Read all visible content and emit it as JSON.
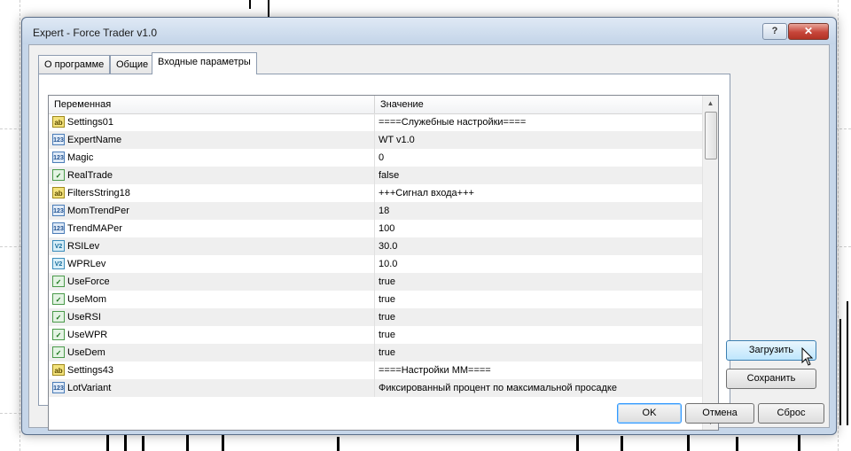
{
  "window": {
    "title": "Expert - Force Trader v1.0",
    "help_label": "?",
    "close_label": "✕"
  },
  "tabs": [
    {
      "label": "О программе",
      "active": false
    },
    {
      "label": "Общие",
      "active": false
    },
    {
      "label": "Входные параметры",
      "active": true
    }
  ],
  "grid": {
    "columns": [
      "Переменная",
      "Значение"
    ],
    "rows": [
      {
        "icon": "ab",
        "name": "Settings01",
        "value": "====Служебные настройки===="
      },
      {
        "icon": "123",
        "name": "ExpertName",
        "value": "WT v1.0"
      },
      {
        "icon": "123",
        "name": "Magic",
        "value": "0"
      },
      {
        "icon": "bool",
        "name": "RealTrade",
        "value": "false"
      },
      {
        "icon": "ab",
        "name": "FiltersString18",
        "value": "+++Сигнал входа+++"
      },
      {
        "icon": "123",
        "name": "MomTrendPer",
        "value": "18"
      },
      {
        "icon": "123",
        "name": "TrendMAPer",
        "value": "100"
      },
      {
        "icon": "dbl",
        "name": "RSILev",
        "value": "30.0"
      },
      {
        "icon": "dbl",
        "name": "WPRLev",
        "value": "10.0"
      },
      {
        "icon": "bool",
        "name": "UseForce",
        "value": "true"
      },
      {
        "icon": "bool",
        "name": "UseMom",
        "value": "true"
      },
      {
        "icon": "bool",
        "name": "UseRSI",
        "value": "true"
      },
      {
        "icon": "bool",
        "name": "UseWPR",
        "value": "true"
      },
      {
        "icon": "bool",
        "name": "UseDem",
        "value": "true"
      },
      {
        "icon": "ab",
        "name": "Settings43",
        "value": "====Настройки ММ===="
      },
      {
        "icon": "123",
        "name": "LotVariant",
        "value": "Фиксированный процент по максимальной просадке"
      }
    ]
  },
  "side_buttons": {
    "load": "Загрузить",
    "save": "Сохранить"
  },
  "footer_buttons": {
    "ok": "OK",
    "cancel": "Отмена",
    "reset": "Сброс"
  },
  "icon_glyphs": {
    "ab": "ab",
    "123": "123",
    "bool": "✓",
    "dbl": "V2"
  }
}
